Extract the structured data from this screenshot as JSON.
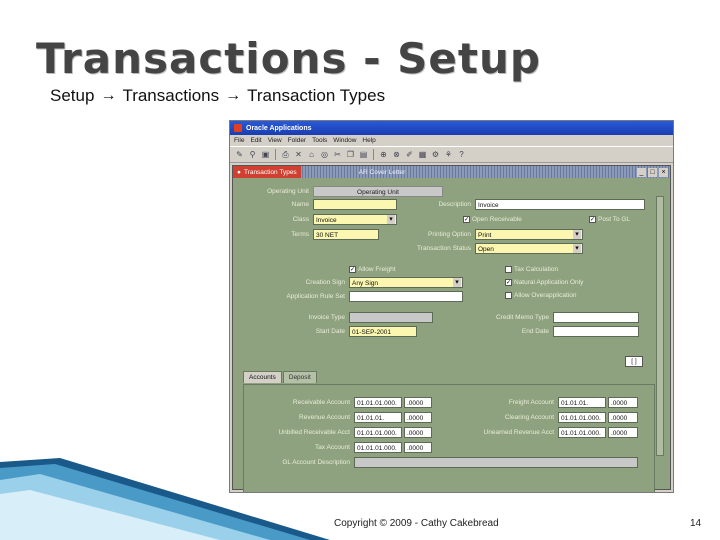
{
  "slide": {
    "title": "Transactions - Setup",
    "breadcrumb": [
      "Setup",
      "Transactions",
      "Transaction Types"
    ],
    "footer": "Copyright © 2009 - Cathy Cakebread",
    "page_number": "14"
  },
  "app": {
    "window_title": "Oracle Applications",
    "menu": [
      "File",
      "Edit",
      "View",
      "Folder",
      "Tools",
      "Window",
      "Help"
    ],
    "form_title": "Transaction Types",
    "form_subtitle": "AR Cover Letter",
    "header": {
      "operating_unit_label": "Operating Unit",
      "operating_unit_value": "Operating Unit",
      "name_label": "Name",
      "name_value": "",
      "description_label": "Description",
      "description_value": "Invoice",
      "class_label": "Class",
      "class_value": "Invoice",
      "terms_label": "Terms",
      "terms_value": "30 NET",
      "printing_option_label": "Printing Option",
      "printing_option_value": "Print",
      "transaction_status_label": "Transaction Status",
      "transaction_status_value": "Open",
      "open_receivable_label": "Open Receivable",
      "post_to_gl_label": "Post To GL",
      "allow_freight_label": "Allow Freight",
      "tax_calculation_label": "Tax Calculation",
      "creation_sign_label": "Creation Sign",
      "creation_sign_value": "Any Sign",
      "natural_app_only_label": "Natural Application Only",
      "allow_overapplication_label": "Allow Overapplication",
      "app_rule_set_label": "Application Rule Set",
      "app_rule_set_value": "",
      "invoice_type_label": "Invoice Type",
      "invoice_type_value": "",
      "credit_memo_type_label": "Credit Memo Type",
      "credit_memo_type_value": "",
      "start_date_label": "Start Date",
      "start_date_value": "01-SEP-2001",
      "end_date_label": "End Date",
      "end_date_value": "",
      "record_indicator": "[ ]"
    },
    "tabs": [
      "Accounts",
      "Deposit"
    ],
    "accounts": {
      "receivable_label": "Receivable Account",
      "receivable_value": "01.01.01.000.",
      "receivable_suffix": ".0000",
      "revenue_label": "Revenue Account",
      "revenue_value": "01.01.01.",
      "revenue_suffix": ".0000",
      "unbilled_label": "Unbilled Receivable Acct",
      "unbilled_value": "01.01.01.000.",
      "unbilled_suffix": ".0000",
      "tax_label": "Tax Account",
      "tax_value": "01.01.01.000.",
      "tax_suffix": ".0000",
      "freight_label": "Freight Account",
      "freight_value": "01.01.01.",
      "freight_suffix": ".0000",
      "clearing_label": "Clearing Account",
      "clearing_value": "01.01.01.000.",
      "clearing_suffix": ".0000",
      "unearned_label": "Unearned Revenue Acct",
      "unearned_value": "01.01.01.000.",
      "unearned_suffix": ".0000",
      "gl_desc_label": "GL Account Description",
      "gl_desc_value": ""
    }
  }
}
